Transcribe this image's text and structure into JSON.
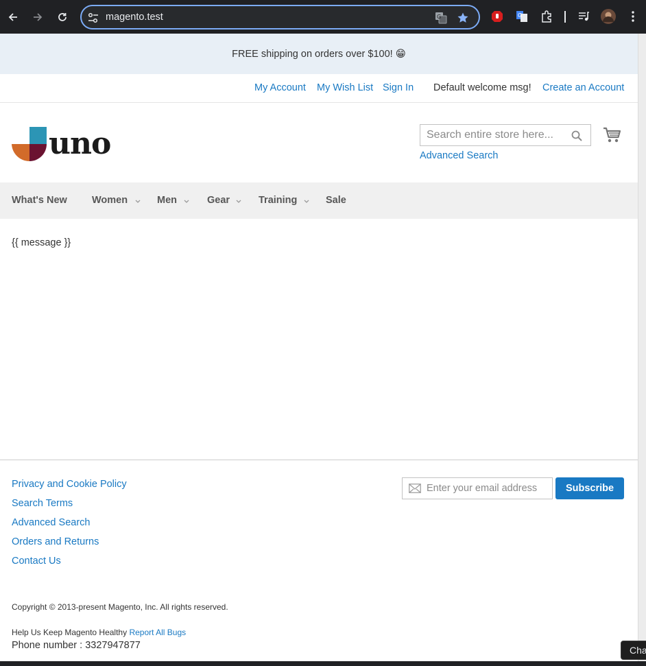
{
  "browser": {
    "url": "magento.test"
  },
  "promo": {
    "text": "FREE shipping on orders over $100! 😁"
  },
  "top_links": {
    "my_account": "My Account",
    "my_wish_list": "My Wish List",
    "sign_in": "Sign In",
    "welcome": "Default welcome msg!",
    "create_account": "Create an Account"
  },
  "header": {
    "logo_text": "uno",
    "search_placeholder": "Search entire store here...",
    "advanced_search": "Advanced Search"
  },
  "nav": {
    "items": [
      {
        "label": "What's New",
        "has_submenu": false
      },
      {
        "label": "Women",
        "has_submenu": true
      },
      {
        "label": "Men",
        "has_submenu": true
      },
      {
        "label": "Gear",
        "has_submenu": true
      },
      {
        "label": "Training",
        "has_submenu": true
      },
      {
        "label": "Sale",
        "has_submenu": false
      }
    ]
  },
  "content": {
    "message": "{{ message }}"
  },
  "footer": {
    "links": [
      "Privacy and Cookie Policy",
      "Search Terms",
      "Advanced Search",
      "Orders and Returns",
      "Contact Us"
    ],
    "newsletter_placeholder": "Enter your email address",
    "subscribe_label": "Subscribe",
    "copyright": "Copyright © 2013-present Magento, Inc. All rights reserved.",
    "healthy_text": "Help Us Keep Magento Healthy",
    "report_bugs": "Report All Bugs",
    "phone": "Phone number : 3327947877"
  },
  "chat": {
    "label": "Cha"
  },
  "colors": {
    "link": "#1979c3",
    "promo_bg": "#e8eff6",
    "nav_bg": "#f0f0f0",
    "logo_orange": "#d26b2a",
    "logo_teal": "#2c95b5",
    "logo_maroon": "#6b1331"
  }
}
